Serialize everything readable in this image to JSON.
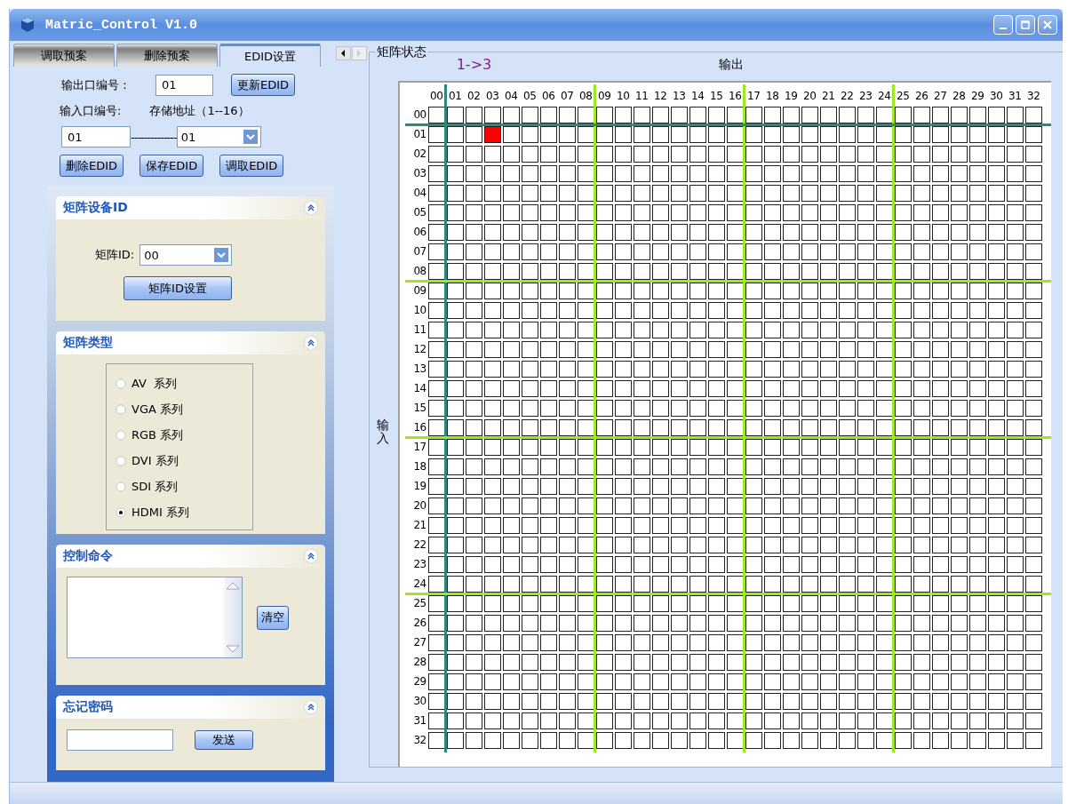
{
  "window": {
    "title": "Matric_Control V1.0"
  },
  "tabs": [
    {
      "label": "调取预案",
      "selected": false
    },
    {
      "label": "删除预案",
      "selected": false
    },
    {
      "label": "EDID设置",
      "selected": true
    }
  ],
  "edid": {
    "output_label": "输出口编号：",
    "output_value": "01",
    "update_button": "更新EDID",
    "input_label": "输入口编号:",
    "address_label": "存储地址（1--16）",
    "input_value": "01",
    "separator": "--------------",
    "address_value": "01",
    "buttons": [
      "删除EDID",
      "保存EDID",
      "调取EDID"
    ]
  },
  "panels": [
    {
      "kind": "device_id",
      "title": "矩阵设备ID",
      "id_label": "矩阵ID:",
      "id_value": "00",
      "button": "矩阵ID设置"
    },
    {
      "kind": "type",
      "title": "矩阵类型",
      "options": [
        {
          "label": "AV  系列",
          "selected": false
        },
        {
          "label": "VGA 系列",
          "selected": false
        },
        {
          "label": "RGB 系列",
          "selected": false
        },
        {
          "label": "DVI 系列",
          "selected": false
        },
        {
          "label": "SDI 系列",
          "selected": false
        },
        {
          "label": "HDMI 系列",
          "selected": true
        }
      ]
    },
    {
      "kind": "command",
      "title": "控制命令",
      "button": "清空"
    },
    {
      "kind": "password",
      "title": "忘记密码",
      "button": "发送"
    }
  ],
  "matrix": {
    "group_title": "矩阵状态",
    "route": "1->3",
    "output_label": "输出",
    "input_label": "输入",
    "columns": [
      "00",
      "01",
      "02",
      "03",
      "04",
      "05",
      "06",
      "07",
      "08",
      "09",
      "10",
      "11",
      "12",
      "13",
      "14",
      "15",
      "16",
      "17",
      "18",
      "19",
      "20",
      "21",
      "22",
      "23",
      "24",
      "25",
      "26",
      "27",
      "28",
      "29",
      "30",
      "31",
      "32"
    ],
    "rows": [
      {
        "label": "00",
        "on": [
          false,
          false,
          false,
          false,
          false,
          false,
          false,
          false,
          false,
          false,
          false,
          false,
          false,
          false,
          false,
          false,
          false,
          false,
          false,
          false,
          false,
          false,
          false,
          false,
          false,
          false,
          false,
          false,
          false,
          false,
          false,
          false,
          false
        ]
      },
      {
        "label": "01",
        "on": [
          false,
          false,
          false,
          true,
          false,
          false,
          false,
          false,
          false,
          false,
          false,
          false,
          false,
          false,
          false,
          false,
          false,
          false,
          false,
          false,
          false,
          false,
          false,
          false,
          false,
          false,
          false,
          false,
          false,
          false,
          false,
          false,
          false
        ]
      },
      {
        "label": "02",
        "on": [
          false,
          false,
          false,
          false,
          false,
          false,
          false,
          false,
          false,
          false,
          false,
          false,
          false,
          false,
          false,
          false,
          false,
          false,
          false,
          false,
          false,
          false,
          false,
          false,
          false,
          false,
          false,
          false,
          false,
          false,
          false,
          false,
          false
        ]
      },
      {
        "label": "03",
        "on": [
          false,
          false,
          false,
          false,
          false,
          false,
          false,
          false,
          false,
          false,
          false,
          false,
          false,
          false,
          false,
          false,
          false,
          false,
          false,
          false,
          false,
          false,
          false,
          false,
          false,
          false,
          false,
          false,
          false,
          false,
          false,
          false,
          false
        ]
      },
      {
        "label": "04",
        "on": [
          false,
          false,
          false,
          false,
          false,
          false,
          false,
          false,
          false,
          false,
          false,
          false,
          false,
          false,
          false,
          false,
          false,
          false,
          false,
          false,
          false,
          false,
          false,
          false,
          false,
          false,
          false,
          false,
          false,
          false,
          false,
          false,
          false
        ]
      },
      {
        "label": "05",
        "on": [
          false,
          false,
          false,
          false,
          false,
          false,
          false,
          false,
          false,
          false,
          false,
          false,
          false,
          false,
          false,
          false,
          false,
          false,
          false,
          false,
          false,
          false,
          false,
          false,
          false,
          false,
          false,
          false,
          false,
          false,
          false,
          false,
          false
        ]
      },
      {
        "label": "06",
        "on": [
          false,
          false,
          false,
          false,
          false,
          false,
          false,
          false,
          false,
          false,
          false,
          false,
          false,
          false,
          false,
          false,
          false,
          false,
          false,
          false,
          false,
          false,
          false,
          false,
          false,
          false,
          false,
          false,
          false,
          false,
          false,
          false,
          false
        ]
      },
      {
        "label": "07",
        "on": [
          false,
          false,
          false,
          false,
          false,
          false,
          false,
          false,
          false,
          false,
          false,
          false,
          false,
          false,
          false,
          false,
          false,
          false,
          false,
          false,
          false,
          false,
          false,
          false,
          false,
          false,
          false,
          false,
          false,
          false,
          false,
          false,
          false
        ]
      },
      {
        "label": "08",
        "on": [
          false,
          false,
          false,
          false,
          false,
          false,
          false,
          false,
          false,
          false,
          false,
          false,
          false,
          false,
          false,
          false,
          false,
          false,
          false,
          false,
          false,
          false,
          false,
          false,
          false,
          false,
          false,
          false,
          false,
          false,
          false,
          false,
          false
        ]
      },
      {
        "label": "09",
        "on": [
          false,
          false,
          false,
          false,
          false,
          false,
          false,
          false,
          false,
          false,
          false,
          false,
          false,
          false,
          false,
          false,
          false,
          false,
          false,
          false,
          false,
          false,
          false,
          false,
          false,
          false,
          false,
          false,
          false,
          false,
          false,
          false,
          false
        ]
      },
      {
        "label": "10",
        "on": [
          false,
          false,
          false,
          false,
          false,
          false,
          false,
          false,
          false,
          false,
          false,
          false,
          false,
          false,
          false,
          false,
          false,
          false,
          false,
          false,
          false,
          false,
          false,
          false,
          false,
          false,
          false,
          false,
          false,
          false,
          false,
          false,
          false
        ]
      },
      {
        "label": "11",
        "on": [
          false,
          false,
          false,
          false,
          false,
          false,
          false,
          false,
          false,
          false,
          false,
          false,
          false,
          false,
          false,
          false,
          false,
          false,
          false,
          false,
          false,
          false,
          false,
          false,
          false,
          false,
          false,
          false,
          false,
          false,
          false,
          false,
          false
        ]
      },
      {
        "label": "12",
        "on": [
          false,
          false,
          false,
          false,
          false,
          false,
          false,
          false,
          false,
          false,
          false,
          false,
          false,
          false,
          false,
          false,
          false,
          false,
          false,
          false,
          false,
          false,
          false,
          false,
          false,
          false,
          false,
          false,
          false,
          false,
          false,
          false,
          false
        ]
      },
      {
        "label": "13",
        "on": [
          false,
          false,
          false,
          false,
          false,
          false,
          false,
          false,
          false,
          false,
          false,
          false,
          false,
          false,
          false,
          false,
          false,
          false,
          false,
          false,
          false,
          false,
          false,
          false,
          false,
          false,
          false,
          false,
          false,
          false,
          false,
          false,
          false
        ]
      },
      {
        "label": "14",
        "on": [
          false,
          false,
          false,
          false,
          false,
          false,
          false,
          false,
          false,
          false,
          false,
          false,
          false,
          false,
          false,
          false,
          false,
          false,
          false,
          false,
          false,
          false,
          false,
          false,
          false,
          false,
          false,
          false,
          false,
          false,
          false,
          false,
          false
        ]
      },
      {
        "label": "15",
        "on": [
          false,
          false,
          false,
          false,
          false,
          false,
          false,
          false,
          false,
          false,
          false,
          false,
          false,
          false,
          false,
          false,
          false,
          false,
          false,
          false,
          false,
          false,
          false,
          false,
          false,
          false,
          false,
          false,
          false,
          false,
          false,
          false,
          false
        ]
      },
      {
        "label": "16",
        "on": [
          false,
          false,
          false,
          false,
          false,
          false,
          false,
          false,
          false,
          false,
          false,
          false,
          false,
          false,
          false,
          false,
          false,
          false,
          false,
          false,
          false,
          false,
          false,
          false,
          false,
          false,
          false,
          false,
          false,
          false,
          false,
          false,
          false
        ]
      },
      {
        "label": "17",
        "on": [
          false,
          false,
          false,
          false,
          false,
          false,
          false,
          false,
          false,
          false,
          false,
          false,
          false,
          false,
          false,
          false,
          false,
          false,
          false,
          false,
          false,
          false,
          false,
          false,
          false,
          false,
          false,
          false,
          false,
          false,
          false,
          false,
          false
        ]
      },
      {
        "label": "18",
        "on": [
          false,
          false,
          false,
          false,
          false,
          false,
          false,
          false,
          false,
          false,
          false,
          false,
          false,
          false,
          false,
          false,
          false,
          false,
          false,
          false,
          false,
          false,
          false,
          false,
          false,
          false,
          false,
          false,
          false,
          false,
          false,
          false,
          false
        ]
      },
      {
        "label": "19",
        "on": [
          false,
          false,
          false,
          false,
          false,
          false,
          false,
          false,
          false,
          false,
          false,
          false,
          false,
          false,
          false,
          false,
          false,
          false,
          false,
          false,
          false,
          false,
          false,
          false,
          false,
          false,
          false,
          false,
          false,
          false,
          false,
          false,
          false
        ]
      },
      {
        "label": "20",
        "on": [
          false,
          false,
          false,
          false,
          false,
          false,
          false,
          false,
          false,
          false,
          false,
          false,
          false,
          false,
          false,
          false,
          false,
          false,
          false,
          false,
          false,
          false,
          false,
          false,
          false,
          false,
          false,
          false,
          false,
          false,
          false,
          false,
          false
        ]
      },
      {
        "label": "21",
        "on": [
          false,
          false,
          false,
          false,
          false,
          false,
          false,
          false,
          false,
          false,
          false,
          false,
          false,
          false,
          false,
          false,
          false,
          false,
          false,
          false,
          false,
          false,
          false,
          false,
          false,
          false,
          false,
          false,
          false,
          false,
          false,
          false,
          false
        ]
      },
      {
        "label": "22",
        "on": [
          false,
          false,
          false,
          false,
          false,
          false,
          false,
          false,
          false,
          false,
          false,
          false,
          false,
          false,
          false,
          false,
          false,
          false,
          false,
          false,
          false,
          false,
          false,
          false,
          false,
          false,
          false,
          false,
          false,
          false,
          false,
          false,
          false
        ]
      },
      {
        "label": "23",
        "on": [
          false,
          false,
          false,
          false,
          false,
          false,
          false,
          false,
          false,
          false,
          false,
          false,
          false,
          false,
          false,
          false,
          false,
          false,
          false,
          false,
          false,
          false,
          false,
          false,
          false,
          false,
          false,
          false,
          false,
          false,
          false,
          false,
          false
        ]
      },
      {
        "label": "24",
        "on": [
          false,
          false,
          false,
          false,
          false,
          false,
          false,
          false,
          false,
          false,
          false,
          false,
          false,
          false,
          false,
          false,
          false,
          false,
          false,
          false,
          false,
          false,
          false,
          false,
          false,
          false,
          false,
          false,
          false,
          false,
          false,
          false,
          false
        ]
      },
      {
        "label": "25",
        "on": [
          false,
          false,
          false,
          false,
          false,
          false,
          false,
          false,
          false,
          false,
          false,
          false,
          false,
          false,
          false,
          false,
          false,
          false,
          false,
          false,
          false,
          false,
          false,
          false,
          false,
          false,
          false,
          false,
          false,
          false,
          false,
          false,
          false
        ]
      },
      {
        "label": "26",
        "on": [
          false,
          false,
          false,
          false,
          false,
          false,
          false,
          false,
          false,
          false,
          false,
          false,
          false,
          false,
          false,
          false,
          false,
          false,
          false,
          false,
          false,
          false,
          false,
          false,
          false,
          false,
          false,
          false,
          false,
          false,
          false,
          false,
          false
        ]
      },
      {
        "label": "27",
        "on": [
          false,
          false,
          false,
          false,
          false,
          false,
          false,
          false,
          false,
          false,
          false,
          false,
          false,
          false,
          false,
          false,
          false,
          false,
          false,
          false,
          false,
          false,
          false,
          false,
          false,
          false,
          false,
          false,
          false,
          false,
          false,
          false,
          false
        ]
      },
      {
        "label": "28",
        "on": [
          false,
          false,
          false,
          false,
          false,
          false,
          false,
          false,
          false,
          false,
          false,
          false,
          false,
          false,
          false,
          false,
          false,
          false,
          false,
          false,
          false,
          false,
          false,
          false,
          false,
          false,
          false,
          false,
          false,
          false,
          false,
          false,
          false
        ]
      },
      {
        "label": "29",
        "on": [
          false,
          false,
          false,
          false,
          false,
          false,
          false,
          false,
          false,
          false,
          false,
          false,
          false,
          false,
          false,
          false,
          false,
          false,
          false,
          false,
          false,
          false,
          false,
          false,
          false,
          false,
          false,
          false,
          false,
          false,
          false,
          false,
          false
        ]
      },
      {
        "label": "30",
        "on": [
          false,
          false,
          false,
          false,
          false,
          false,
          false,
          false,
          false,
          false,
          false,
          false,
          false,
          false,
          false,
          false,
          false,
          false,
          false,
          false,
          false,
          false,
          false,
          false,
          false,
          false,
          false,
          false,
          false,
          false,
          false,
          false,
          false
        ]
      },
      {
        "label": "31",
        "on": [
          false,
          false,
          false,
          false,
          false,
          false,
          false,
          false,
          false,
          false,
          false,
          false,
          false,
          false,
          false,
          false,
          false,
          false,
          false,
          false,
          false,
          false,
          false,
          false,
          false,
          false,
          false,
          false,
          false,
          false,
          false,
          false,
          false
        ]
      },
      {
        "label": "32",
        "on": [
          false,
          false,
          false,
          false,
          false,
          false,
          false,
          false,
          false,
          false,
          false,
          false,
          false,
          false,
          false,
          false,
          false,
          false,
          false,
          false,
          false,
          false,
          false,
          false,
          false,
          false,
          false,
          false,
          false,
          false,
          false,
          false,
          false
        ]
      }
    ]
  }
}
